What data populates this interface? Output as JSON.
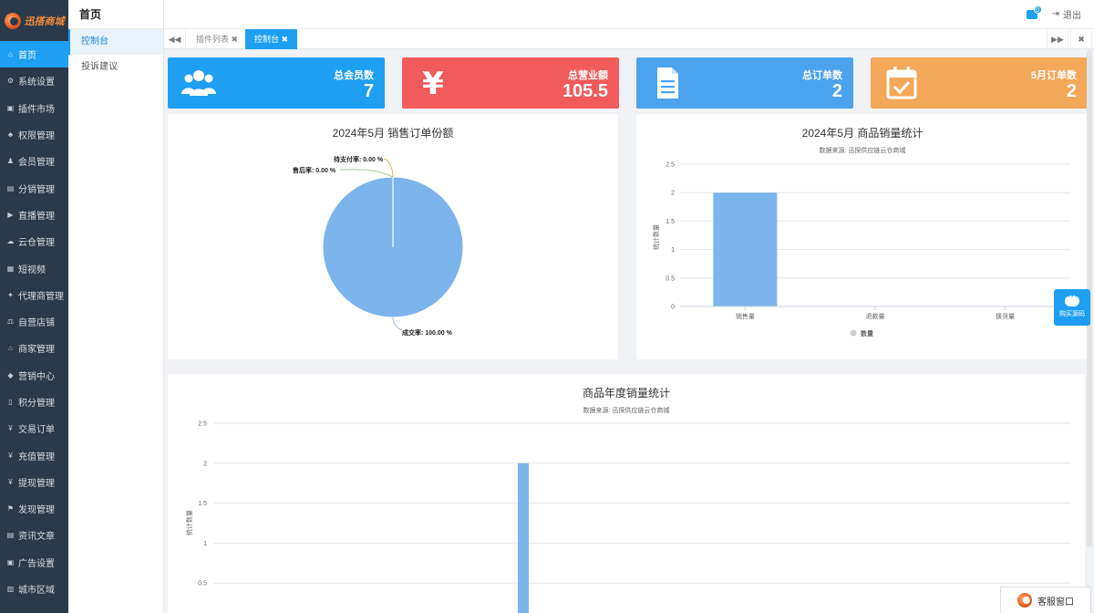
{
  "logo": {
    "text": "迅搭商城"
  },
  "sidebar": {
    "items": [
      {
        "label": "首页",
        "icon": "home-icon",
        "glyph": "⌂",
        "active": true
      },
      {
        "label": "系统设置",
        "icon": "gear-icon",
        "glyph": "⚙"
      },
      {
        "label": "插件市场",
        "icon": "plugin-icon",
        "glyph": "▣"
      },
      {
        "label": "权限管理",
        "icon": "sitemap-icon",
        "glyph": "♣"
      },
      {
        "label": "会员管理",
        "icon": "users-icon",
        "glyph": "♟"
      },
      {
        "label": "分销管理",
        "icon": "share-icon",
        "glyph": "▤"
      },
      {
        "label": "直播管理",
        "icon": "video-icon",
        "glyph": "▶"
      },
      {
        "label": "云仓管理",
        "icon": "cloud-icon",
        "glyph": "☁"
      },
      {
        "label": "短视频",
        "icon": "film-icon",
        "glyph": "▦"
      },
      {
        "label": "代理商管理",
        "icon": "agent-icon",
        "glyph": "✦"
      },
      {
        "label": "自营店铺",
        "icon": "shop-icon",
        "glyph": "⚖"
      },
      {
        "label": "商家管理",
        "icon": "bank-icon",
        "glyph": "⌂"
      },
      {
        "label": "营销中心",
        "icon": "tag-icon",
        "glyph": "◆"
      },
      {
        "label": "积分管理",
        "icon": "file-icon",
        "glyph": "▯"
      },
      {
        "label": "交易订单",
        "icon": "currency-icon",
        "glyph": "¥"
      },
      {
        "label": "充值管理",
        "icon": "yen-icon",
        "glyph": "¥"
      },
      {
        "label": "提现管理",
        "icon": "yen-icon",
        "glyph": "¥"
      },
      {
        "label": "发现管理",
        "icon": "flag-icon",
        "glyph": "⚑"
      },
      {
        "label": "资讯文章",
        "icon": "news-icon",
        "glyph": "▤"
      },
      {
        "label": "广告设置",
        "icon": "image-icon",
        "glyph": "▣"
      },
      {
        "label": "城市区域",
        "icon": "map-icon",
        "glyph": "▥"
      }
    ]
  },
  "subnav": {
    "title": "首页",
    "items": [
      {
        "label": "控制台",
        "active": true
      },
      {
        "label": "投诉建议"
      }
    ]
  },
  "topbar": {
    "badge": "0",
    "logout": "退出"
  },
  "tabs": [
    {
      "label": "插件列表 ✖"
    },
    {
      "label": "控制台 ✖",
      "active": true
    }
  ],
  "cards": [
    {
      "label": "总会员数",
      "value": "7",
      "color": "#1e9ff2",
      "icon": "users-icon"
    },
    {
      "label": "总营业额",
      "value": "105.5",
      "color": "#f25b5b",
      "icon": "yen-icon"
    },
    {
      "label": "总订单数",
      "value": "2",
      "color": "#4ba3ee",
      "icon": "document-icon"
    },
    {
      "label": "5月订单数",
      "value": "2",
      "color": "#f4a85a",
      "icon": "calendar-check-icon"
    }
  ],
  "pie_panel": {
    "title": "2024年5月 销售订单份额",
    "chart_data": {
      "type": "pie",
      "title": "2024年5月 销售订单份额",
      "slices": [
        {
          "label": "待支付率: 0.00 %",
          "value": 0.0
        },
        {
          "label": "售后率: 0.00 %",
          "value": 0.0
        },
        {
          "label": "成交率: 100.00 %",
          "value": 100.0
        }
      ],
      "color": "#7cb5ec"
    }
  },
  "bar_panel": {
    "title": "2024年5月 商品销量统计",
    "subtitle": "数据来源: 迅探供应链云仓商城",
    "ylabel": "统计数量",
    "legend": "数量",
    "chart_data": {
      "type": "bar",
      "categories": [
        "销售量",
        "退款量",
        "换货量"
      ],
      "series": [
        {
          "name": "数量",
          "values": [
            2,
            0,
            0
          ]
        }
      ],
      "yticks": [
        "0",
        "0.5",
        "1",
        "1.5",
        "2",
        "2.5"
      ],
      "ylim": [
        0,
        2.5
      ],
      "legend_position": "bottom-center",
      "color": "#7cb5ec"
    }
  },
  "annual_panel": {
    "title": "商品年度销量统计",
    "subtitle": "数据来源: 迅探供应链云仓商城",
    "ylabel": "统计数量",
    "chart_data": {
      "type": "bar",
      "categories": [],
      "series": [
        {
          "values": [
            2
          ]
        }
      ],
      "yticks": [
        "0.5",
        "1",
        "1.5",
        "2",
        "2.5"
      ],
      "ylim": [
        0,
        2.5
      ],
      "color": "#7cb5ec"
    }
  },
  "floating": {
    "buy_label": "购买源码",
    "cs_label": "客服窗口"
  }
}
